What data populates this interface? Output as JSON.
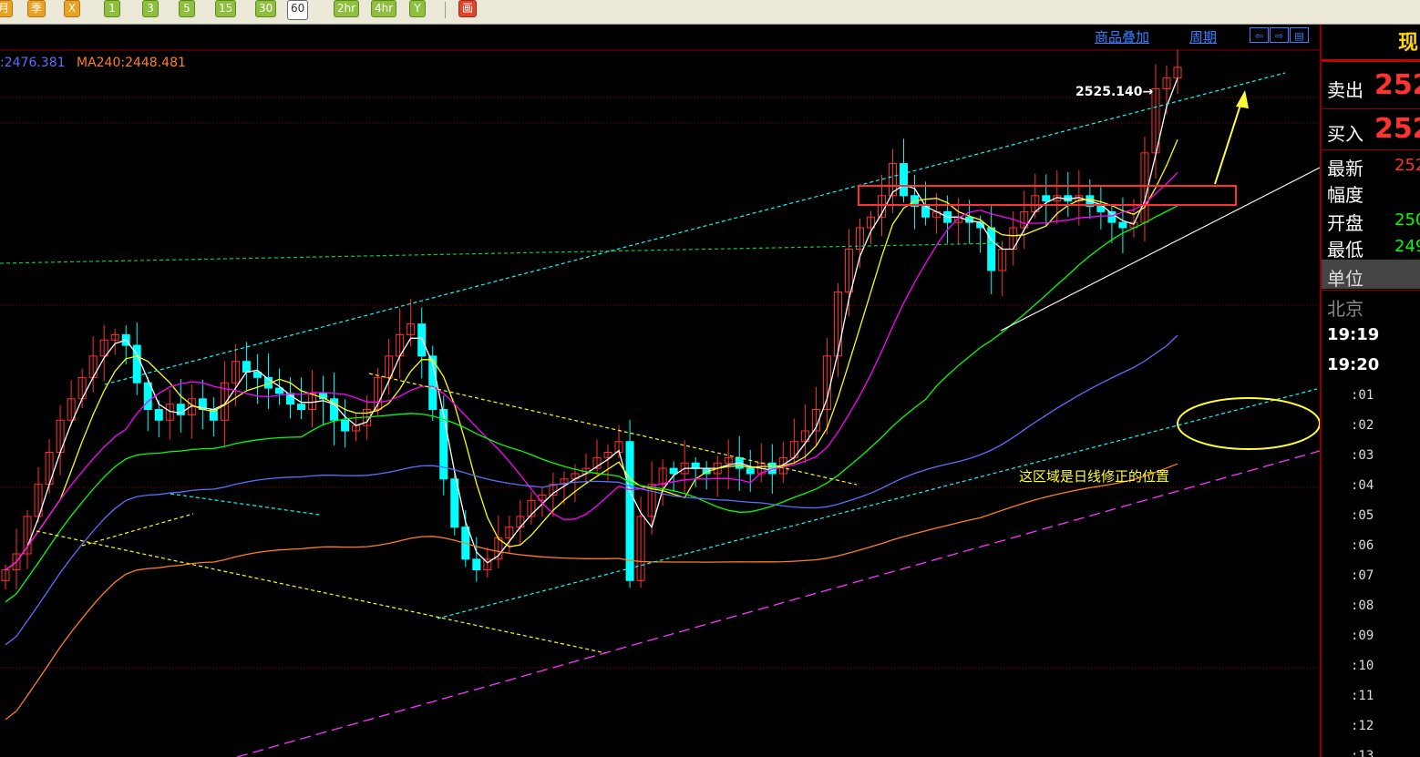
{
  "toolbar": {
    "buttons": [
      {
        "label": "月",
        "style": "orange"
      },
      {
        "label": "季",
        "style": "orange"
      },
      {
        "label": "X",
        "style": "orange"
      },
      {
        "label": "1",
        "style": "green"
      },
      {
        "label": "3",
        "style": "green"
      },
      {
        "label": "5",
        "style": "green"
      },
      {
        "label": "15",
        "style": "green"
      },
      {
        "label": "30",
        "style": "green"
      },
      {
        "label": "60",
        "style": "active"
      },
      {
        "label": "2hr",
        "style": "green"
      },
      {
        "label": "4hr",
        "style": "green"
      },
      {
        "label": "Y",
        "style": "green"
      },
      {
        "label": "画",
        "style": "red"
      }
    ]
  },
  "chart_header": {
    "overlay_link": "商品叠加",
    "period_link": "周期",
    "nav_icons": [
      "left-arrow-icon",
      "right-arrow-icon",
      "panel-icon"
    ]
  },
  "ma_legend": {
    "ma_partial": ":2476.381",
    "ma240": "MA240:2448.481",
    "colors": {
      "ma_partial": "#5b6fff",
      "ma240": "#ff7f1e"
    }
  },
  "price_marker": "2525.140→",
  "annotation_text": "这区域是日线修正的位置",
  "right_panel": {
    "title": "现",
    "sell_label": "卖出",
    "sell_value": "252",
    "buy_label": "买入",
    "buy_value": "252",
    "latest_label": "最新",
    "latest_value": "252",
    "range_label": "幅度",
    "open_label": "开盘",
    "open_value": "250",
    "low_label": "最低",
    "low_value": "249",
    "unit_label": "单位",
    "city": "北京",
    "time1": "19:19",
    "time2": "19:20",
    "ticks": [
      ":01",
      ":02",
      ":03",
      ":04",
      ":05",
      ":06",
      ":07",
      ":08",
      ":09",
      ":10",
      ":11",
      ":12",
      ":13"
    ]
  },
  "colors": {
    "background": "#000000",
    "up_candle": "#ff3232",
    "down_candle": "#00ffff",
    "grid": "#8b0000",
    "ma5": "#ffffff",
    "ma10": "#ffff00",
    "ma20": "#ff00ff",
    "ma60": "#00ff00",
    "ma120": "#5b6fff",
    "ma240": "#ff7f1e",
    "trend_cyan": "#00ffff",
    "trend_yellow": "#ffff00",
    "trend_magenta": "#ff33ff",
    "trend_white": "#ffffff",
    "box_red": "#ff3030",
    "ellipse_yellow": "#ffff33"
  },
  "chart_data": {
    "type": "candlestick",
    "title": "",
    "interval": "60",
    "y_range": [
      2395,
      2532
    ],
    "price_marker_value": 2525.14,
    "key_levels": [
      {
        "name": "recent_high",
        "value": 2525.14
      },
      {
        "name": "resistance_box_top",
        "value": 2506
      },
      {
        "name": "resistance_box_bottom",
        "value": 2502
      }
    ],
    "moving_averages": [
      {
        "name": "MA240",
        "last_value": 2448.481
      }
    ],
    "closes": [
      2430,
      2433,
      2440,
      2446,
      2452,
      2458,
      2462,
      2466,
      2470,
      2473,
      2474,
      2472,
      2465,
      2460,
      2458,
      2461,
      2459,
      2462,
      2460,
      2458,
      2465,
      2469,
      2467,
      2466,
      2464,
      2463,
      2461,
      2460,
      2463,
      2462,
      2458,
      2456,
      2457,
      2460,
      2466,
      2470,
      2474,
      2476,
      2470,
      2460,
      2447,
      2438,
      2432,
      2430,
      2432,
      2436,
      2438,
      2440,
      2443,
      2444,
      2446,
      2447,
      2448,
      2449,
      2451,
      2452,
      2454,
      2428,
      2440,
      2446,
      2449,
      2448,
      2450,
      2449,
      2448,
      2450,
      2451,
      2449,
      2448,
      2450,
      2448,
      2451,
      2454,
      2456,
      2460,
      2470,
      2482,
      2490,
      2494,
      2496,
      2500,
      2506,
      2500,
      2498,
      2496,
      2497,
      2495,
      2496,
      2495,
      2494,
      2486,
      2490,
      2494,
      2497,
      2500,
      2499,
      2500,
      2499,
      2500,
      2498,
      2497,
      2495,
      2494,
      2495,
      2508,
      2520,
      2522,
      2524
    ]
  }
}
